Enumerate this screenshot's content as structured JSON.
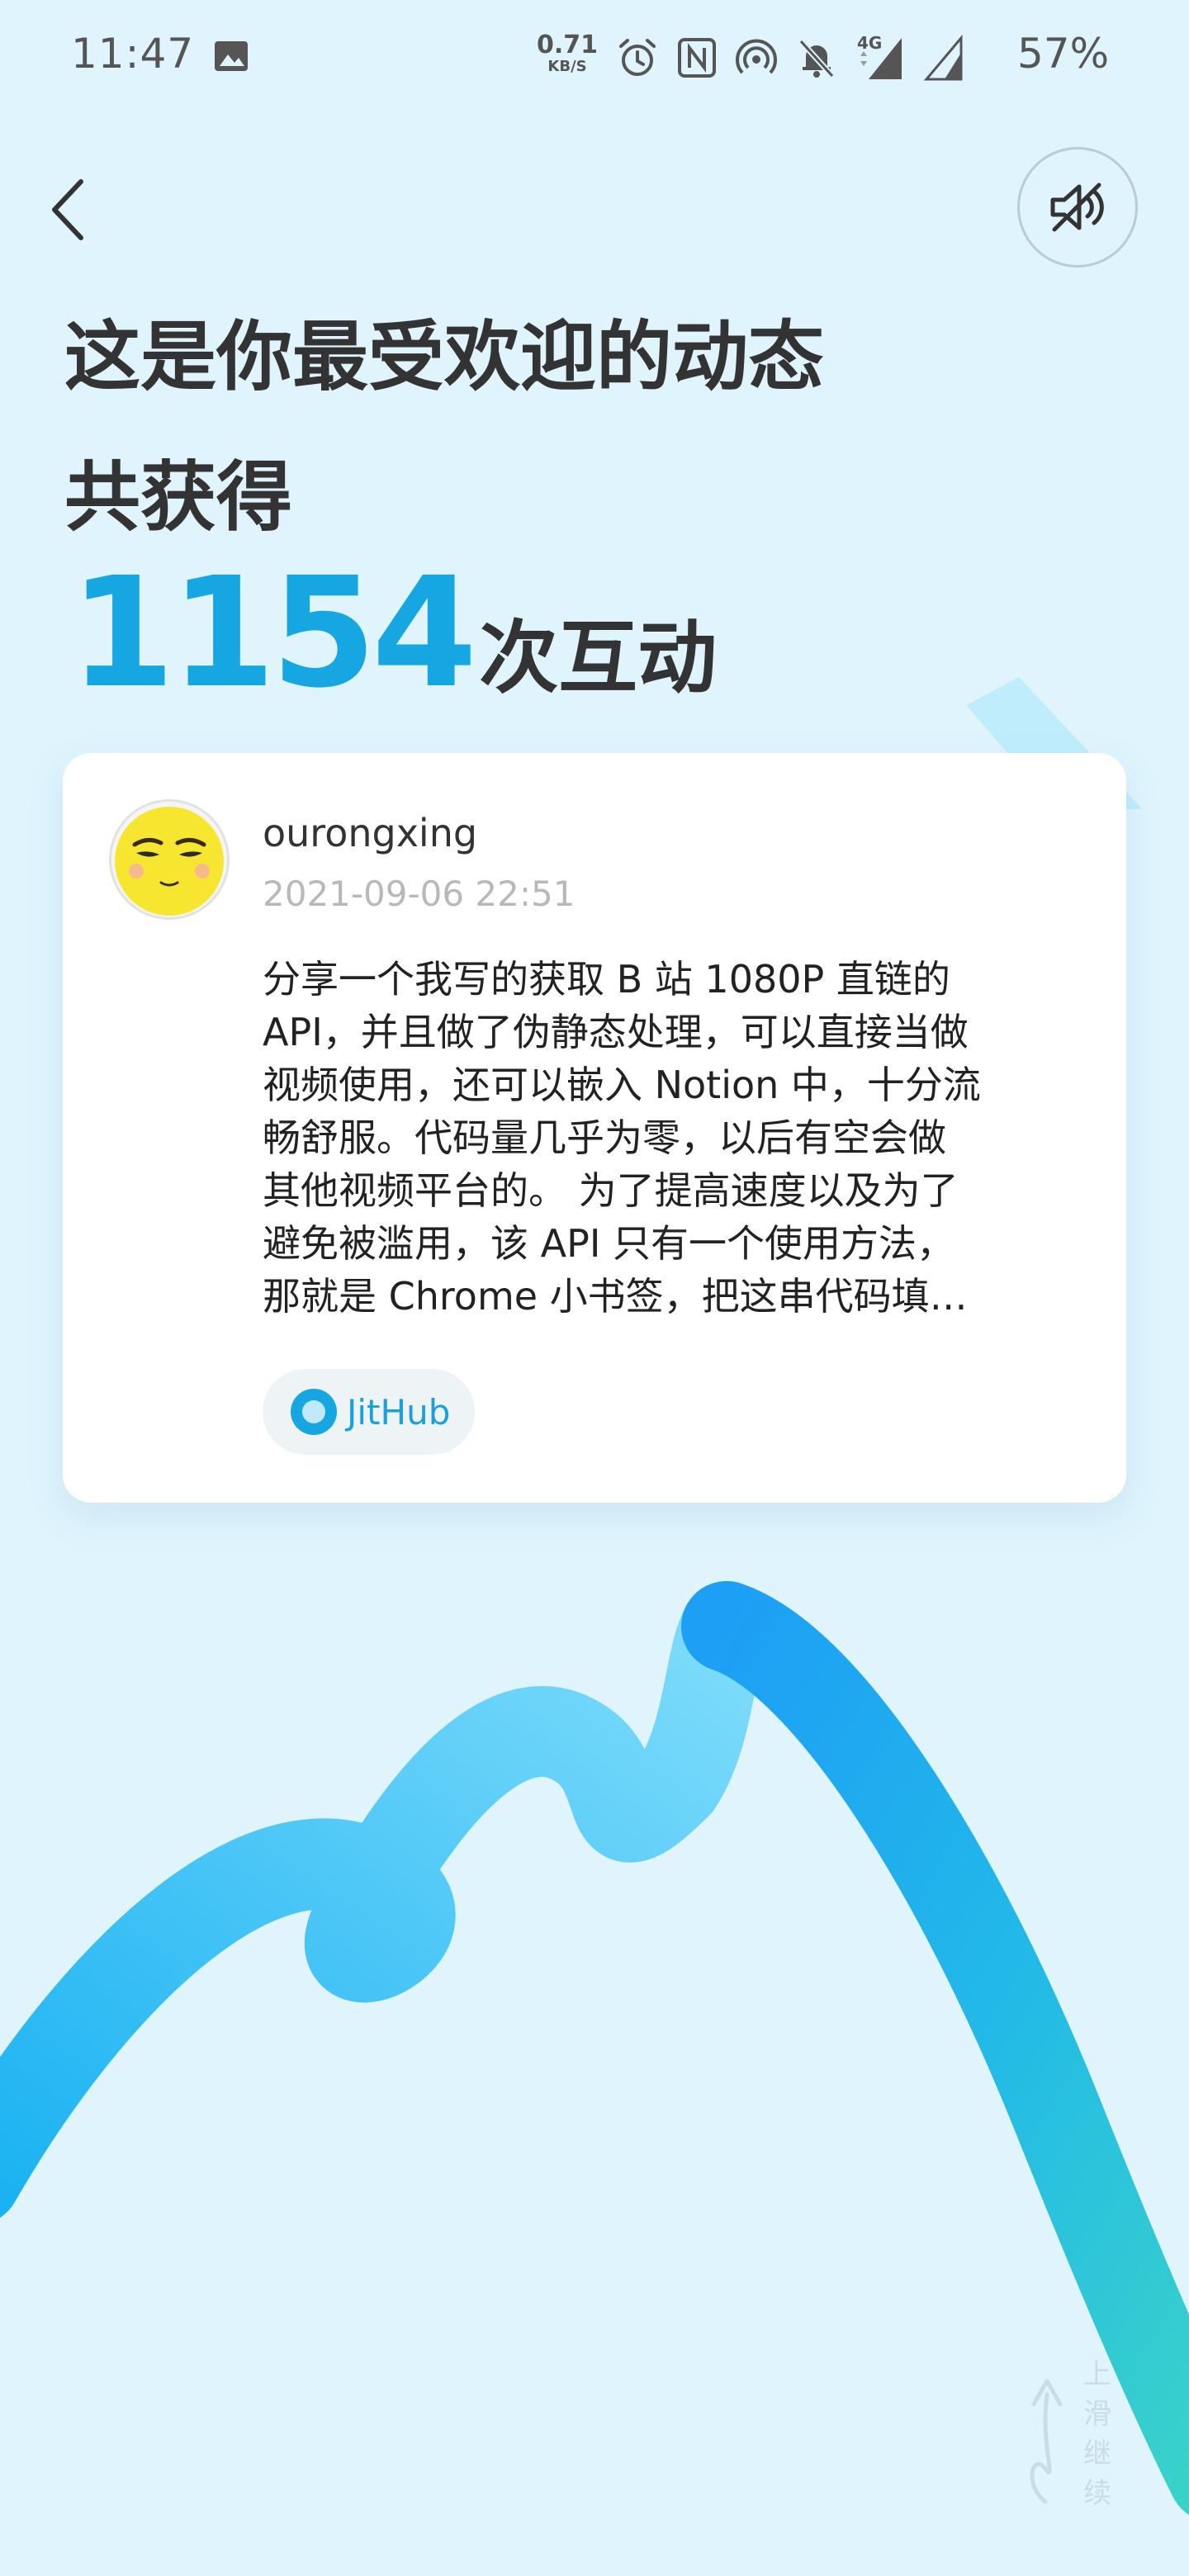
{
  "status_bar": {
    "time": "11:47",
    "net_speed_value": "0.71",
    "net_speed_unit": "KB/S",
    "network_type": "4G",
    "battery": "57%"
  },
  "header": {
    "title_line1": "这是你最受欢迎的动态",
    "title_line2": "共获得",
    "count": "1154",
    "count_unit": "次互动"
  },
  "post": {
    "username": "ourongxing",
    "timestamp": "2021-09-06 22:51",
    "lines": [
      "分享一个我写的获取 B 站 1080P 直链的",
      "API，并且做了伪静态处理，可以直接当做",
      "视频使用，还可以嵌入 Notion 中，十分流",
      "畅舒服。代码量几乎为零，以后有空会做",
      "其他视频平台的。 为了提高速度以及为了",
      "避免被滥用，该 API 只有一个使用方法，",
      "那就是 Chrome 小书签，把这串代码填…"
    ],
    "tag": "JitHub"
  },
  "swipe_hint": {
    "chars": [
      "上",
      "滑",
      "继",
      "续"
    ]
  },
  "colors": {
    "background": "#dff4fd",
    "accent": "#16a6e2",
    "wave_start": "#1db4f0",
    "wave_end": "#3ad3c8"
  }
}
